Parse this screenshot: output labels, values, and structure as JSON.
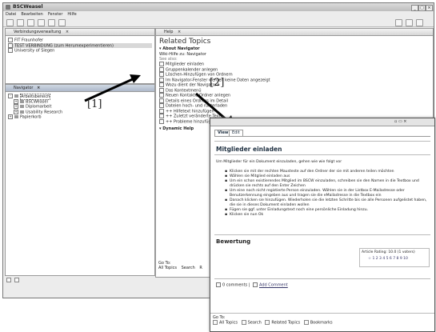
{
  "window": {
    "title": "BSCWeasel"
  },
  "menu": [
    "Datei",
    "Bearbeiten",
    "Fenster",
    "Hilfe"
  ],
  "connections": {
    "tab_label": "Verbindungsverwaltung",
    "items": [
      "FIT Fraunhofer",
      "TEST VERBINDUNG (zum Herumexperimentieren)",
      "University of Siegen"
    ]
  },
  "navigator": {
    "tab_label": "Navigator",
    "tree": [
      {
        "label": "Arbeitsbereich",
        "level": 0,
        "expander": "-"
      },
      {
        "label": "BSCWeasel",
        "level": 1,
        "expander": "+"
      },
      {
        "label": "Diplomarbeit",
        "level": 1,
        "expander": "+"
      },
      {
        "label": "Usability Research",
        "level": 1,
        "expander": "+"
      },
      {
        "label": "Papierkorb",
        "level": 0,
        "expander": "+"
      }
    ]
  },
  "help": {
    "tab_label": "Help",
    "title": "Related Topics",
    "about_header": "About Navigator",
    "about_text": "Wiki-Hilfe zu: Navigator",
    "see_also": "See also:",
    "topics": [
      "Mitglieder einladen",
      "Gruppenkalender anlegen",
      "Löschen-Hinzufügen von Ordnern",
      "Im Navigator-Fenster werden keine Daten angezeigt",
      "Wozu dient der Navigator?",
      "Das Kontextmenü",
      "Neuen Kontakte-Ordner anlegen",
      "Details eines Ordners im Detail",
      "Dateien hoch- und runterladen",
      "++ Hilfetext hinzufügen",
      "++ Zuletzt veränderte Texte",
      "++ Probleme hinzufügen u"
    ],
    "dynamic_header": "Dynamic Help",
    "footer_goto": "Go To:",
    "footer_links": [
      "All Topics",
      "Search",
      "R"
    ]
  },
  "annotations": {
    "label1": "[1]",
    "label2": "[2]"
  },
  "wiki": {
    "tabs": [
      "View",
      "Edit"
    ],
    "heading": "Mitglieder einladen",
    "intro": "Um Mitglieder für ein Dokument einzuladen, gehen wie wie folgt vor",
    "steps": [
      "Klicken sie mit der rechten Mausteste auf den Ordner der sie mit anderen teilen möchten",
      "Wählen sie Mitglied einladen aus",
      "Um ein schon existierendes Mitglied im BSCW einzuladen, schreiben sie den Namen in die Textbox und drücken sie rechts auf den Enter Zeichen",
      "Um eine noch nicht registierte Person einzuladen. Wählen sie in der Listbox E-Mailadresse oder Benutzerkennung eingeben aus und tragen sie die eMailadresse in die Textbox ein",
      "Danach klicken sie hinzufügen. Wiederholen sie die letzten Schritte bis sie alle Personen aufgelistet haben, die sie in dieses Dokument einladen wollen",
      "Fügen sie ggf. unter Einladungstext noch eine persönliche Einladung hinzu.",
      "Klicken sie nun Ok"
    ],
    "rating_header": "Bewertung",
    "rating_text": "Article Rating: 10.0 (1 voters)",
    "rating_scale": "1 2 3 4 5 6 7 8 9 10",
    "comments": "0 comments |",
    "add_comment": "Add Comment",
    "footer_goto": "Go To:",
    "footer_links": [
      "All Topics",
      "Search",
      "Related Topics",
      "Bookmarks"
    ]
  }
}
